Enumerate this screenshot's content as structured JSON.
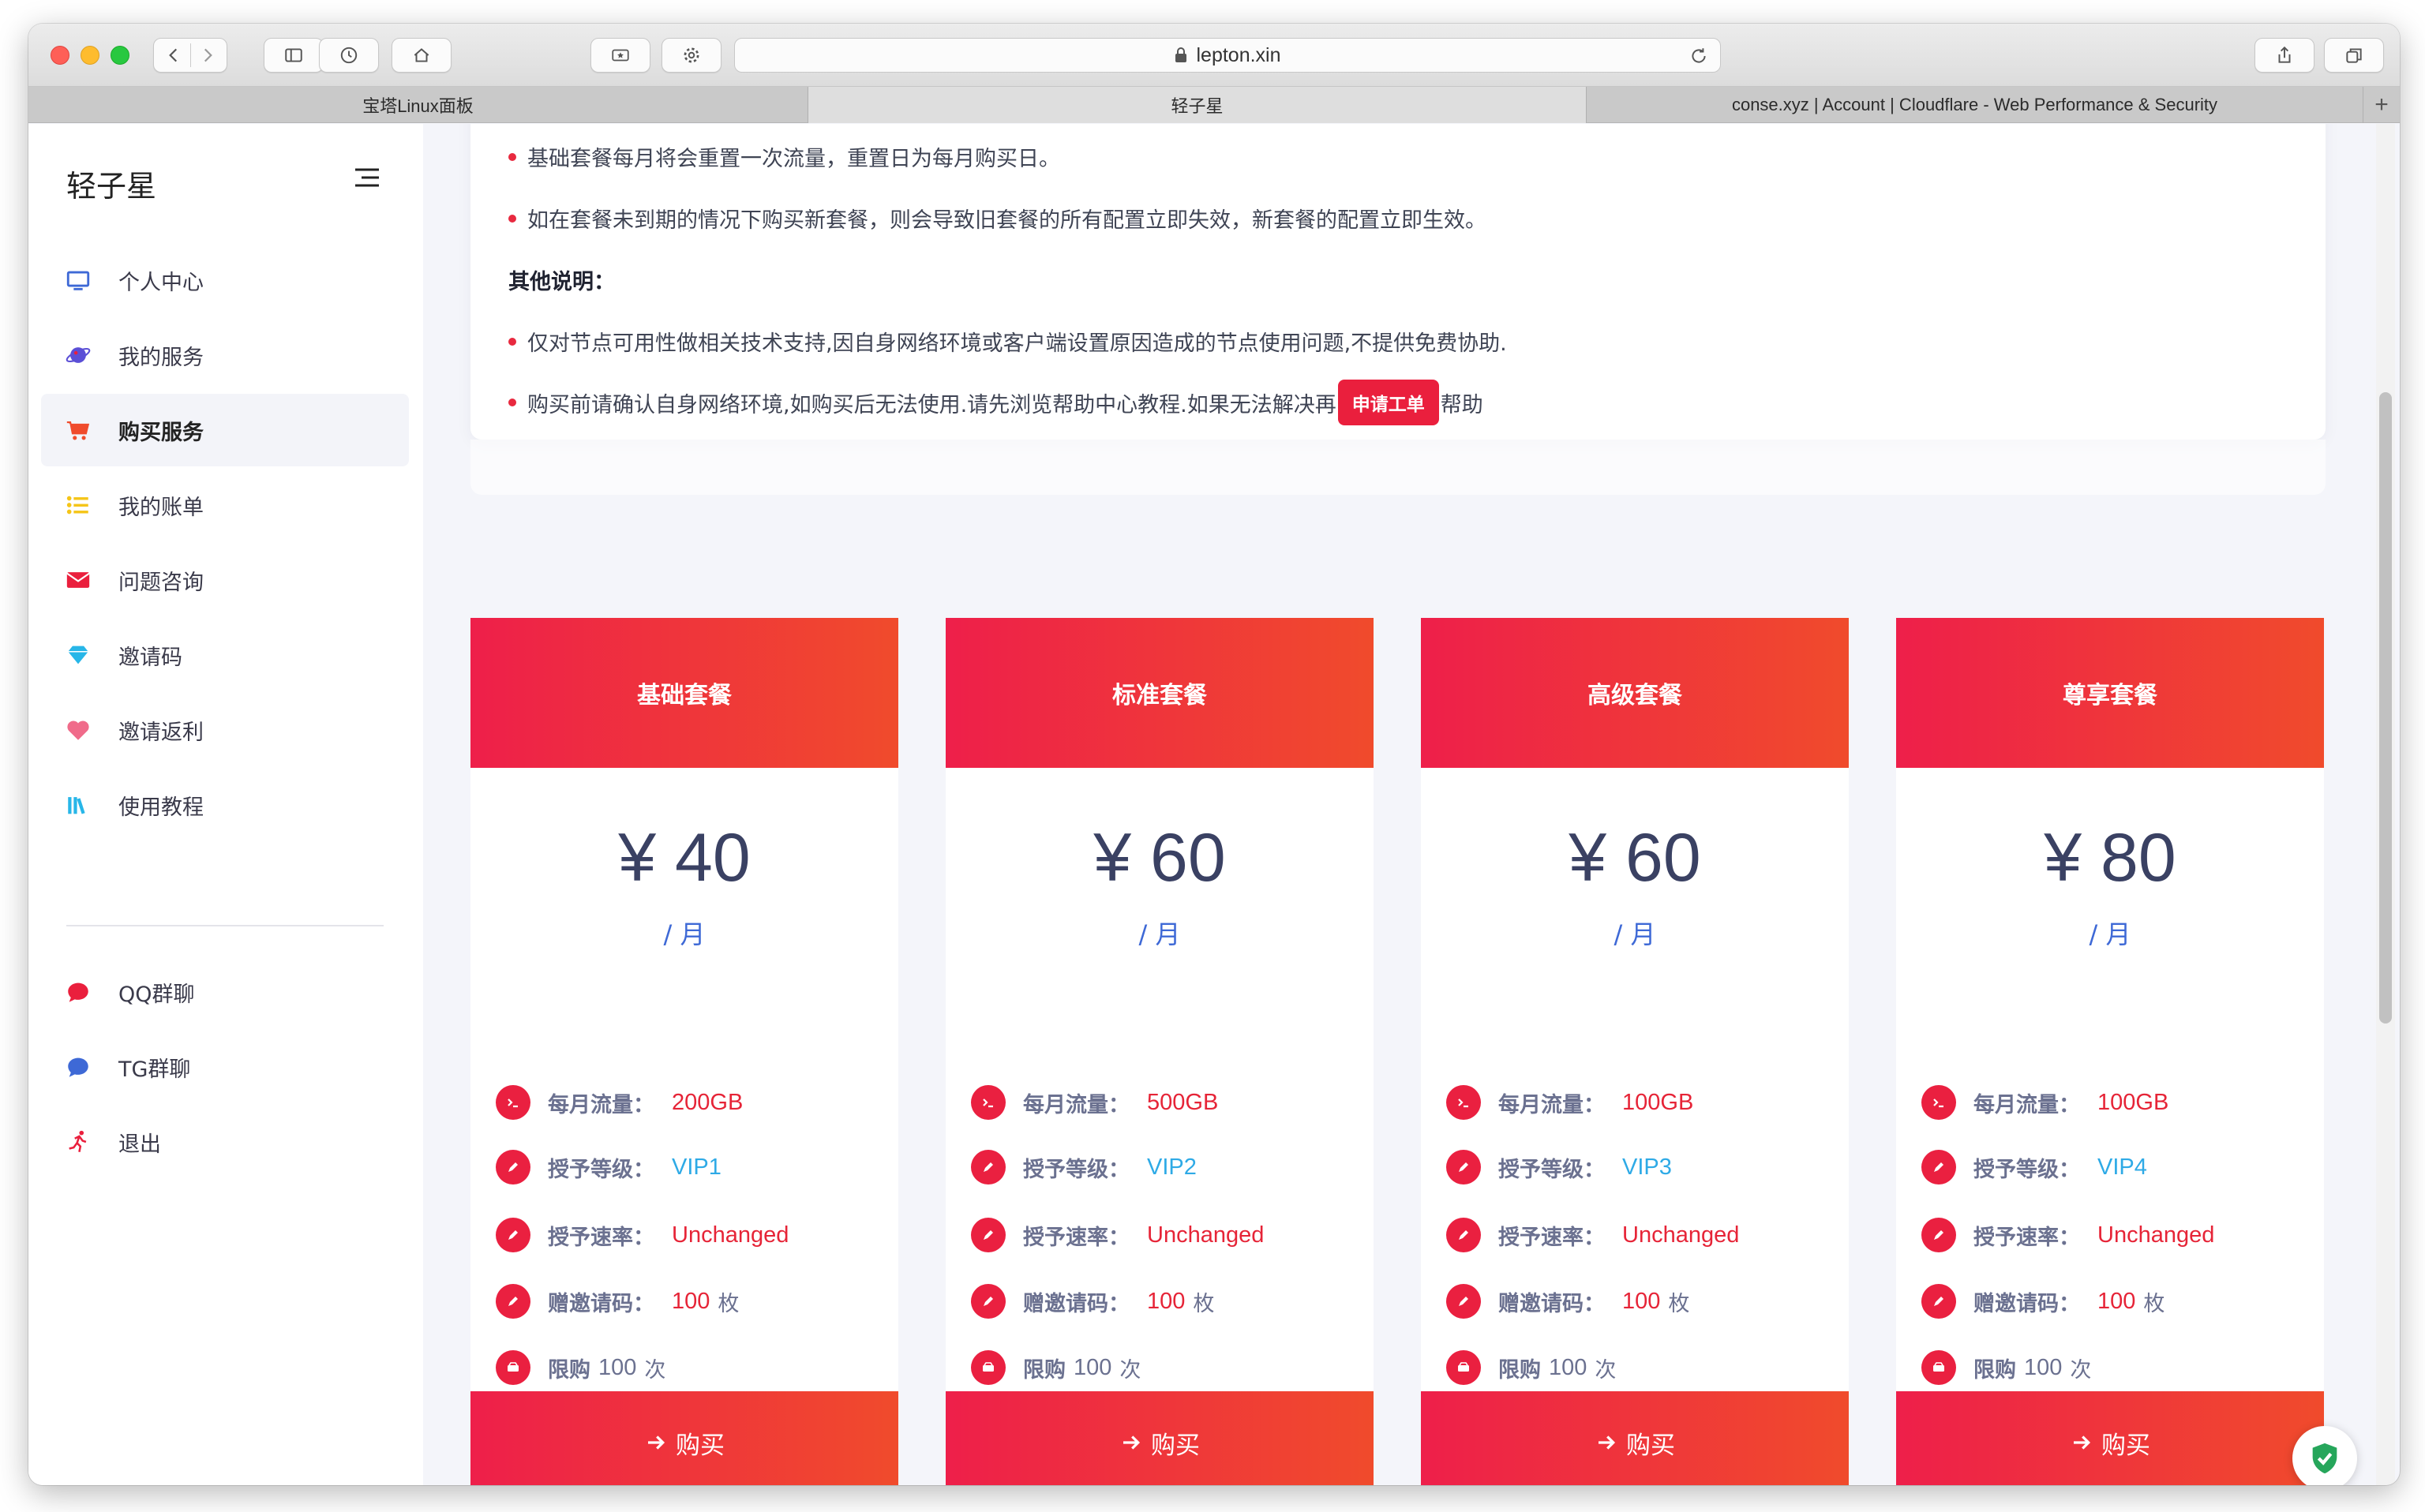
{
  "browser": {
    "url": "lepton.xin",
    "tabs": [
      "宝塔Linux面板",
      "轻子星",
      "conse.xyz | Account | Cloudflare - Web Performance & Security"
    ],
    "active_tab": 1
  },
  "sidebar": {
    "brand": "轻子星",
    "items": [
      {
        "label": "个人中心",
        "icon": "monitor-icon",
        "color": "#3e69d6"
      },
      {
        "label": "我的服务",
        "icon": "planet-icon",
        "color": "#5b4fd6"
      },
      {
        "label": "购买服务",
        "icon": "cart-icon",
        "color": "#f04b2c"
      },
      {
        "label": "我的账单",
        "icon": "list-icon",
        "color": "#f5c518"
      },
      {
        "label": "问题咨询",
        "icon": "mail-icon",
        "color": "#ea1f3d"
      },
      {
        "label": "邀请码",
        "icon": "diamond-icon",
        "color": "#27b6e8"
      },
      {
        "label": "邀请返利",
        "icon": "heart-icon",
        "color": "#f06b8a"
      },
      {
        "label": "使用教程",
        "icon": "books-icon",
        "color": "#27b6e8"
      },
      {
        "label": "QQ群聊",
        "icon": "chat-bubble-icon",
        "color": "#ea1f3d"
      },
      {
        "label": "TG群聊",
        "icon": "chat-bubble-icon",
        "color": "#3e69d6"
      },
      {
        "label": "退出",
        "icon": "running-icon",
        "color": "#ea1f3d"
      }
    ],
    "active_index": 2
  },
  "notice": {
    "line1": "基础套餐每月将会重置一次流量，重置日为每月购买日。",
    "line2": "如在套餐未到期的情况下购买新套餐，则会导致旧套餐的所有配置立即失效，新套餐的配置立即生效。",
    "other_heading": "其他说明：",
    "line3": "仅对节点可用性做相关技术支持,因自身网络环境或客户端设置原因造成的节点使用问题,不提供免费协助.",
    "line4_before": "购买前请确认自身网络环境,如购买后无法使用.请先浏览帮助中心教程.如果无法解决再",
    "ticket_button": "申请工单",
    "line4_after": "帮助"
  },
  "labels": {
    "traffic": "每月流量：",
    "level": "授予等级：",
    "speed": "授予速率：",
    "invite": "赠邀请码：",
    "invite_unit": "枚",
    "limit": "限购",
    "limit_unit": "次",
    "period": "/ 月",
    "buy": "购买"
  },
  "plans": [
    {
      "name": "基础套餐",
      "price": "¥ 40",
      "traffic": "200GB",
      "level": "VIP1",
      "speed": "Unchanged",
      "invite": "100",
      "limit": "100"
    },
    {
      "name": "标准套餐",
      "price": "¥ 60",
      "traffic": "500GB",
      "level": "VIP2",
      "speed": "Unchanged",
      "invite": "100",
      "limit": "100"
    },
    {
      "name": "高级套餐",
      "price": "¥ 60",
      "traffic": "100GB",
      "level": "VIP3",
      "speed": "Unchanged",
      "invite": "100",
      "limit": "100"
    },
    {
      "name": "尊享套餐",
      "price": "¥ 80",
      "traffic": "100GB",
      "level": "VIP4",
      "speed": "Unchanged",
      "invite": "100",
      "limit": "100"
    }
  ],
  "colors": {
    "accent": "#ea1f3d",
    "gradient_start": "#ee1f4a",
    "gradient_end": "#f04b2c",
    "price": "#3a4163",
    "period": "#3e69d6",
    "level": "#2eaae6"
  }
}
